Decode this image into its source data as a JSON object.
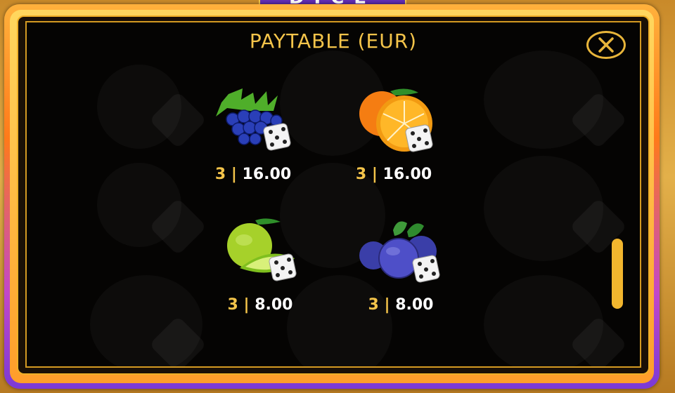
{
  "header": {
    "logo_text": "DICE"
  },
  "paytable": {
    "title": "PAYTABLE (EUR)",
    "close_label": "close",
    "symbols": [
      {
        "name": "grapes",
        "count": "3",
        "separator": "|",
        "value": "16.00"
      },
      {
        "name": "orange",
        "count": "3",
        "separator": "|",
        "value": "16.00"
      },
      {
        "name": "lime",
        "count": "3",
        "separator": "|",
        "value": "8.00"
      },
      {
        "name": "blueberry",
        "count": "3",
        "separator": "|",
        "value": "8.00"
      }
    ]
  },
  "colors": {
    "accent": "#f4c44a",
    "panel_bg": "#050403",
    "frame_orange": "#ff7a1a",
    "frame_purple": "#7b3ad6"
  }
}
